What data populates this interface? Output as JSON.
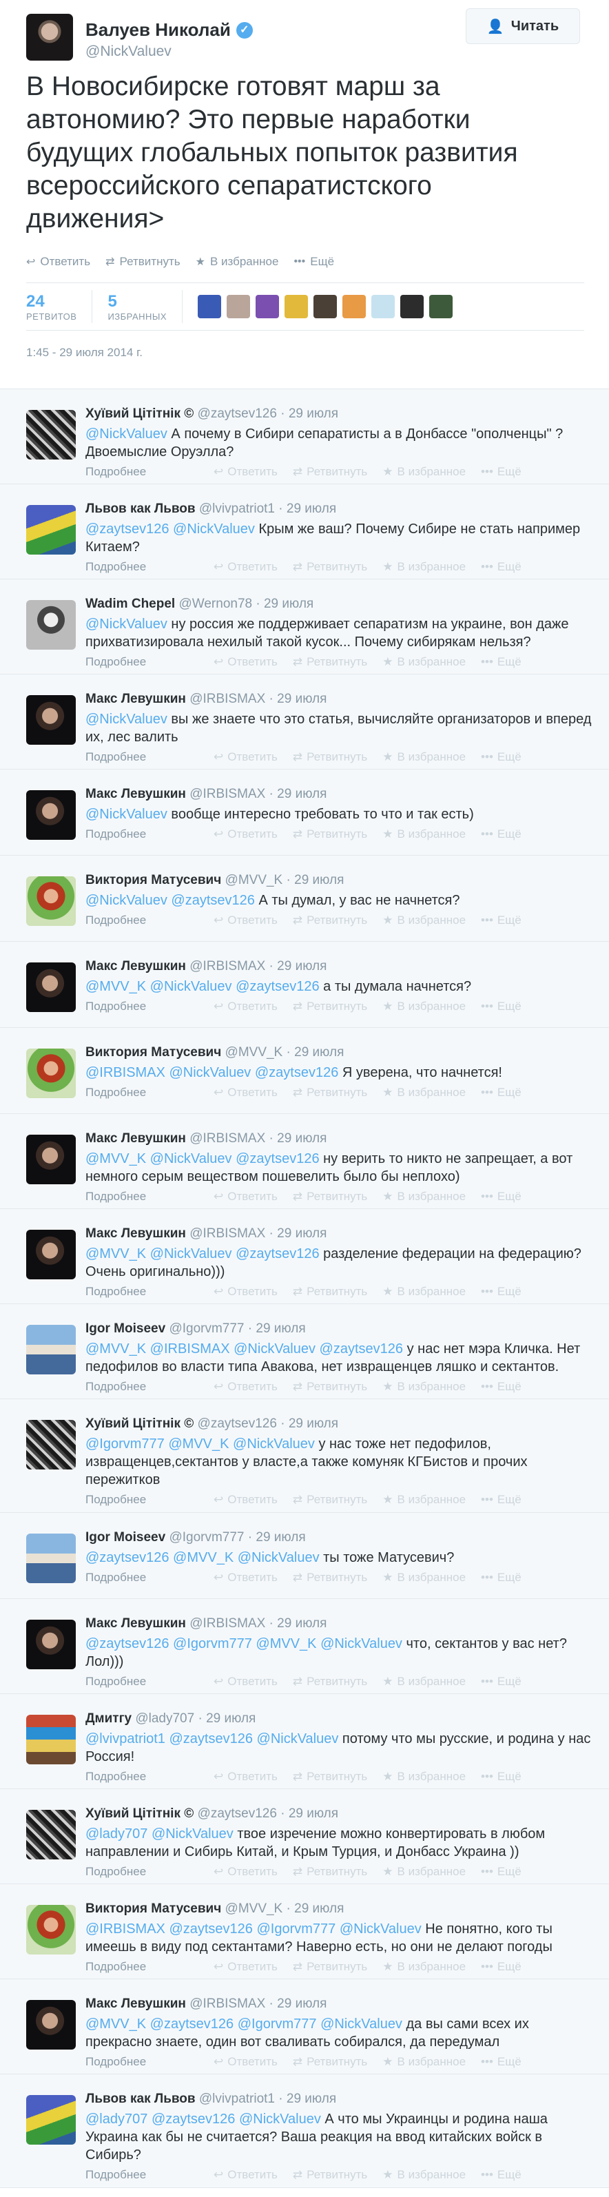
{
  "author": {
    "name": "Валуев Николай",
    "handle": "@NickValuev",
    "verified_icon": "check-icon",
    "follow_label": "Читать",
    "follow_icon": "add-user-icon"
  },
  "tweet": {
    "text": "В Новосибирске готовят марш за автономию? Это первые наработки будущих глобальных попыток развития всероссийского сепаратистского движения>",
    "actions": {
      "reply": "Ответить",
      "retweet": "Ретвитнуть",
      "favorite": "В избранное",
      "more": "Ещё"
    },
    "retweets_count": "24",
    "retweets_label": "РЕТВИТОВ",
    "favorites_count": "5",
    "favorites_label": "ИЗБРАННЫХ",
    "timestamp": "1:45 - 29 июля 2014 г."
  },
  "reply_actions": {
    "details": "Подробнее",
    "reply": "Ответить",
    "retweet": "Ретвитнуть",
    "favorite": "В избранное",
    "more": "Ещё"
  },
  "replies": [
    {
      "name": "Хуївий Цітітнік ©",
      "handle": "@zaytsev126",
      "date": "29 июля",
      "text": "@NickValuev А почему в Сибири сепаратисты а в Донбассе \"ополченцы\" ? Двоемыслие Оруэлла?"
    },
    {
      "name": "Львов как Львов",
      "handle": "@lvivpatriot1",
      "date": "29 июля",
      "text": "@zaytsev126 @NickValuev Крым же ваш? Почему Сибире не стать например Китаем?"
    },
    {
      "name": "Wadim Chepel",
      "handle": "@Wernon78",
      "date": "29 июля",
      "text": "@NickValuev ну россия же поддерживает сепаратизм на украине, вон даже прихватизировала нехилый такой кусок... Почему сибирякам нельзя?"
    },
    {
      "name": "Макс Левушкин",
      "handle": "@IRBISMAX",
      "date": "29 июля",
      "text": "@NickValuev вы же знаете что это статья, вычисляйте организаторов и вперед их, лес валить"
    },
    {
      "name": "Макс Левушкин",
      "handle": "@IRBISMAX",
      "date": "29 июля",
      "text": "@NickValuev вообще интересно требовать то что и так есть)"
    },
    {
      "name": "Виктория Матусевич",
      "handle": "@MVV_K",
      "date": "29 июля",
      "text": "@NickValuev @zaytsev126 А ты думал, у вас не начнется?"
    },
    {
      "name": "Макс Левушкин",
      "handle": "@IRBISMAX",
      "date": "29 июля",
      "text": "@MVV_K @NickValuev @zaytsev126 а ты думала начнется?"
    },
    {
      "name": "Виктория Матусевич",
      "handle": "@MVV_K",
      "date": "29 июля",
      "text": "@IRBISMAX @NickValuev @zaytsev126 Я уверена, что начнется!"
    },
    {
      "name": "Макс Левушкин",
      "handle": "@IRBISMAX",
      "date": "29 июля",
      "text": "@MVV_K @NickValuev @zaytsev126 ну верить то никто не запрещает, а вот немного серым веществом пошевелить было бы неплохо)"
    },
    {
      "name": "Макс Левушкин",
      "handle": "@IRBISMAX",
      "date": "29 июля",
      "text": "@MVV_K @NickValuev @zaytsev126 разделение федерации на федерацию? Очень оригинально)))"
    },
    {
      "name": "Igor Moiseev",
      "handle": "@Igorvm777",
      "date": "29 июля",
      "text": "@MVV_K @IRBISMAX @NickValuev @zaytsev126 у нас нет мэра Кличка. Нет педофилов во власти типа Авакова, нет извращенцев ляшко и сектантов."
    },
    {
      "name": "Хуївий Цітітнік ©",
      "handle": "@zaytsev126",
      "date": "29 июля",
      "text": "@Igorvm777 @MVV_K @NickValuev у нас тоже нет педофилов, извращенцев,сектантов у власте,а также комуняк КГБистов и прочих пережитков"
    },
    {
      "name": "Igor Moiseev",
      "handle": "@Igorvm777",
      "date": "29 июля",
      "text": "@zaytsev126 @MVV_K @NickValuev ты тоже Матусевич?"
    },
    {
      "name": "Макс Левушкин",
      "handle": "@IRBISMAX",
      "date": "29 июля",
      "text": "@zaytsev126 @Igorvm777 @MVV_K @NickValuev что, сектантов у вас нет? Лол)))"
    },
    {
      "name": "Дмитгу",
      "handle": "@lady707",
      "date": "29 июля",
      "text": "@lvivpatriot1 @zaytsev126 @NickValuev потому что мы русские, и родина у нас Россия!"
    },
    {
      "name": "Хуївий Цітітнік ©",
      "handle": "@zaytsev126",
      "date": "29 июля",
      "text": "@lady707 @NickValuev твое изречение можно конвертировать в любом направлении и Сибирь Китай, и Крым Турция, и Донбасс Украина ))"
    },
    {
      "name": "Виктория Матусевич",
      "handle": "@MVV_K",
      "date": "29 июля",
      "text": "@IRBISMAX @zaytsev126 @Igorvm777 @NickValuev Не понятно, кого ты имеешь в виду под сектантами? Наверно есть, но они не делают погоды"
    },
    {
      "name": "Макс Левушкин",
      "handle": "@IRBISMAX",
      "date": "29 июля",
      "text": "@MVV_K @zaytsev126 @Igorvm777 @NickValuev да вы сами всех их прекрасно знаете, один вот сваливать собирался, да передумал"
    },
    {
      "name": "Львов как Львов",
      "handle": "@lvivpatriot1",
      "date": "29 июля",
      "text": "@lady707 @zaytsev126 @NickValuev А что мы Украинцы и родина наша Украина как бы не считается? Ваша реакция на ввод китайских войск в Сибирь?"
    }
  ]
}
